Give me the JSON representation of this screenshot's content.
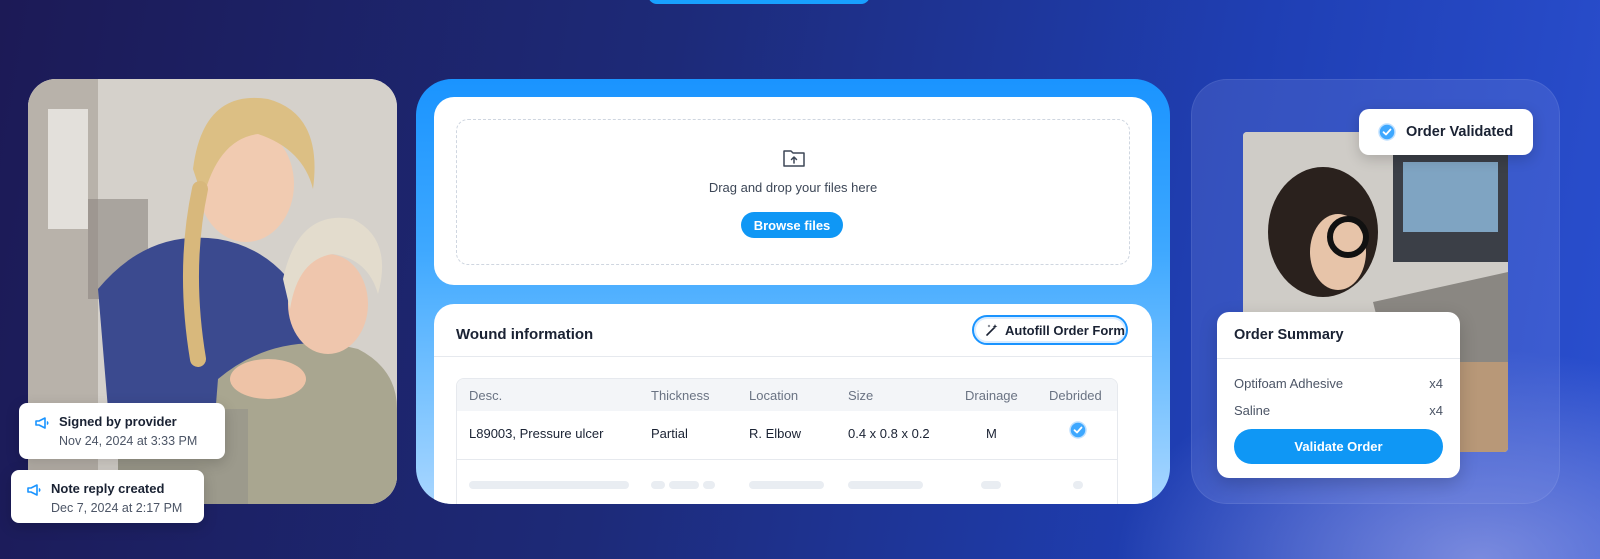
{
  "colors": {
    "accent": "#0f97f5",
    "bg_dark": "#1c1a56",
    "bg_blue": "#2a4fcf"
  },
  "left": {
    "photo": "caregiver-with-senior-patient-photo",
    "toasts": [
      {
        "icon": "megaphone-icon",
        "title": "Signed by provider",
        "time": "Nov 24, 2024 at 3:33 PM"
      },
      {
        "icon": "megaphone-icon",
        "title": "Note reply created",
        "time": "Dec 7, 2024 at 2:17 PM"
      }
    ]
  },
  "upload": {
    "icon": "folder-upload-icon",
    "text": "Drag and drop your files here",
    "browse_label": "Browse files"
  },
  "wound": {
    "title": "Wound information",
    "autofill_label": "Autofill Order Form",
    "autofill_icon": "magic-wand-icon",
    "columns": [
      "Desc.",
      "Thickness",
      "Location",
      "Size",
      "Drainage",
      "Debrided"
    ],
    "rows": [
      {
        "desc": "L89003, Pressure ulcer",
        "thickness": "Partial",
        "location": "R. Elbow",
        "size": "0.4 x 0.8 x 0.2",
        "drainage": "M",
        "debrided": true
      }
    ]
  },
  "right": {
    "photo": "support-agent-with-headset-photo",
    "validated_label": "Order Validated",
    "validated_icon": "check-circle-icon",
    "summary": {
      "title": "Order Summary",
      "items": [
        {
          "name": "Optifoam Adhesive",
          "qty": "x4"
        },
        {
          "name": "Saline",
          "qty": "x4"
        }
      ],
      "button_label": "Validate Order"
    }
  }
}
